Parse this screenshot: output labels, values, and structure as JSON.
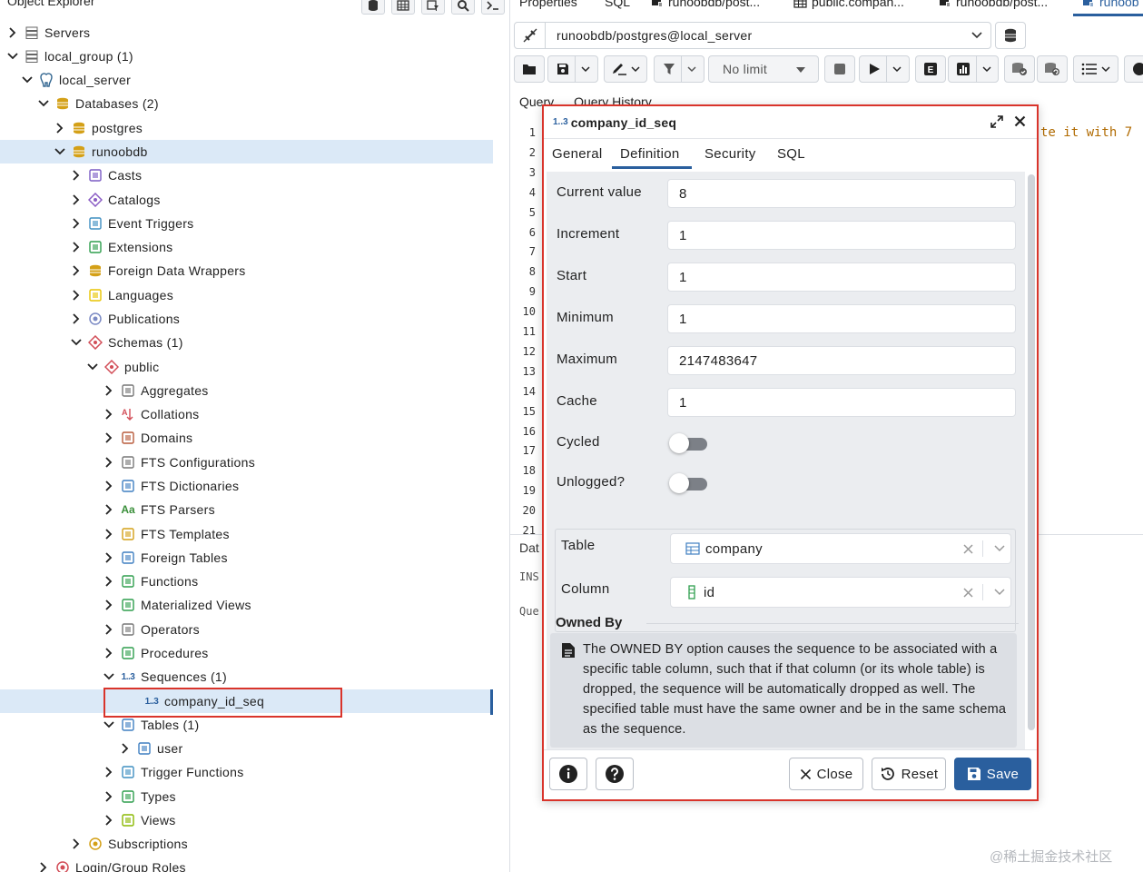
{
  "explorer": {
    "title": "Object Explorer",
    "tree": [
      {
        "label": "Servers",
        "icon": "servers-icon",
        "level": 0,
        "chevron": "right"
      },
      {
        "label": "local_group (1)",
        "icon": "server-group-icon",
        "level": 0,
        "chevron": "down"
      },
      {
        "label": "local_server",
        "icon": "postgres-elephant-icon",
        "level": 1,
        "chevron": "down"
      },
      {
        "label": "Databases (2)",
        "icon": "databases-icon",
        "level": 2,
        "chevron": "down"
      },
      {
        "label": "postgres",
        "icon": "database-icon",
        "level": 3,
        "chevron": "right"
      },
      {
        "label": "runoobdb",
        "icon": "database-icon",
        "level": 3,
        "chevron": "down",
        "highlighted": true
      },
      {
        "label": "Casts",
        "icon": "casts-icon",
        "level": 4,
        "chevron": "right"
      },
      {
        "label": "Catalogs",
        "icon": "catalogs-icon",
        "level": 4,
        "chevron": "right"
      },
      {
        "label": "Event Triggers",
        "icon": "event-triggers-icon",
        "level": 4,
        "chevron": "right"
      },
      {
        "label": "Extensions",
        "icon": "extensions-icon",
        "level": 4,
        "chevron": "right"
      },
      {
        "label": "Foreign Data Wrappers",
        "icon": "foreign-data-wrappers-icon",
        "level": 4,
        "chevron": "right"
      },
      {
        "label": "Languages",
        "icon": "languages-icon",
        "level": 4,
        "chevron": "right"
      },
      {
        "label": "Publications",
        "icon": "publications-icon",
        "level": 4,
        "chevron": "right"
      },
      {
        "label": "Schemas (1)",
        "icon": "schemas-icon",
        "level": 4,
        "chevron": "down"
      },
      {
        "label": "public",
        "icon": "schema-icon",
        "level": 5,
        "chevron": "down"
      },
      {
        "label": "Aggregates",
        "icon": "aggregates-icon",
        "level": 6,
        "chevron": "right"
      },
      {
        "label": "Collations",
        "icon": "collations-icon",
        "level": 6,
        "chevron": "right"
      },
      {
        "label": "Domains",
        "icon": "domains-icon",
        "level": 6,
        "chevron": "right"
      },
      {
        "label": "FTS Configurations",
        "icon": "fts-configurations-icon",
        "level": 6,
        "chevron": "right"
      },
      {
        "label": "FTS Dictionaries",
        "icon": "fts-dictionaries-icon",
        "level": 6,
        "chevron": "right"
      },
      {
        "label": "FTS Parsers",
        "icon": "fts-parsers-icon",
        "level": 6,
        "chevron": "right",
        "glyph": "Aa"
      },
      {
        "label": "FTS Templates",
        "icon": "fts-templates-icon",
        "level": 6,
        "chevron": "right"
      },
      {
        "label": "Foreign Tables",
        "icon": "foreign-tables-icon",
        "level": 6,
        "chevron": "right"
      },
      {
        "label": "Functions",
        "icon": "functions-icon",
        "level": 6,
        "chevron": "right"
      },
      {
        "label": "Materialized Views",
        "icon": "materialized-views-icon",
        "level": 6,
        "chevron": "right"
      },
      {
        "label": "Operators",
        "icon": "operators-icon",
        "level": 6,
        "chevron": "right"
      },
      {
        "label": "Procedures",
        "icon": "procedures-icon",
        "level": 6,
        "chevron": "right"
      },
      {
        "label": "Sequences (1)",
        "icon": "sequences-icon",
        "level": 6,
        "chevron": "down",
        "glyph": "1..3"
      },
      {
        "label": "company_id_seq",
        "icon": "sequence-icon",
        "level": 7,
        "chevron": "none",
        "selected": true,
        "glyph": "1..3"
      },
      {
        "label": "Tables (1)",
        "icon": "tables-icon",
        "level": 6,
        "chevron": "down"
      },
      {
        "label": "user",
        "icon": "table-icon",
        "level": 7,
        "chevron": "right"
      },
      {
        "label": "Trigger Functions",
        "icon": "trigger-functions-icon",
        "level": 6,
        "chevron": "right"
      },
      {
        "label": "Types",
        "icon": "types-icon",
        "level": 6,
        "chevron": "right"
      },
      {
        "label": "Views",
        "icon": "views-icon",
        "level": 6,
        "chevron": "right"
      },
      {
        "label": "Subscriptions",
        "icon": "subscriptions-icon",
        "level": 4,
        "chevron": "right"
      },
      {
        "label": "Login/Group Roles",
        "icon": "login-roles-icon",
        "level": 2,
        "chevron": "right"
      }
    ]
  },
  "tabs": [
    {
      "label": "Properties",
      "icon": ""
    },
    {
      "label": "SQL",
      "icon": ""
    },
    {
      "label": "runoobdb/post...",
      "icon": "query-tool-icon"
    },
    {
      "label": "public.compan...",
      "icon": "table-icon"
    },
    {
      "label": "runoobdb/post...",
      "icon": "query-tool-icon"
    },
    {
      "label": "runoob",
      "icon": "query-tool-icon",
      "active": true
    }
  ],
  "query_tool": {
    "connection": "runoobdb/postgres@local_server",
    "limit": "No limit",
    "query_tabs": [
      "Query",
      "Query History"
    ],
    "line_numbers": [
      "1",
      "2",
      "3",
      "4",
      "5",
      "6",
      "7",
      "8",
      "9",
      "10",
      "11",
      "12",
      "13",
      "14",
      "15",
      "16",
      "17",
      "18",
      "19",
      "20",
      "21"
    ],
    "code_fragment": "te it with 7",
    "lower_tab": "Dat",
    "lower_ins": "INS",
    "lower_que": "Que"
  },
  "dialog": {
    "icon_glyph": "1..3",
    "title": "company_id_seq",
    "tabs": [
      "General",
      "Definition",
      "Security",
      "SQL"
    ],
    "active_tab": "Definition",
    "fields": {
      "current_value": {
        "label": "Current value",
        "value": "8"
      },
      "increment": {
        "label": "Increment",
        "value": "1"
      },
      "start": {
        "label": "Start",
        "value": "1"
      },
      "minimum": {
        "label": "Minimum",
        "value": "1"
      },
      "maximum": {
        "label": "Maximum",
        "value": "2147483647"
      },
      "cache": {
        "label": "Cache",
        "value": "1"
      }
    },
    "cycled": {
      "label": "Cycled",
      "on": false
    },
    "unlogged": {
      "label": "Unlogged?",
      "on": false
    },
    "owned_by": {
      "title": "Owned By",
      "table": {
        "label": "Table",
        "value": "company"
      },
      "column": {
        "label": "Column",
        "value": "id"
      }
    },
    "note": "The OWNED BY option causes the sequence to be associated with a specific table column, such that if that column (or its whole table) is dropped, the sequence will be automatically dropped as well. The specified table must have the same owner and be in the same schema as the sequence.",
    "buttons": {
      "close": "Close",
      "reset": "Reset",
      "save": "Save"
    }
  },
  "watermark": "@稀土掘金技术社区",
  "colors": {
    "accent": "#2a5f9e",
    "highlight": "#dbe9f7",
    "annotation_red": "#d9342b"
  }
}
